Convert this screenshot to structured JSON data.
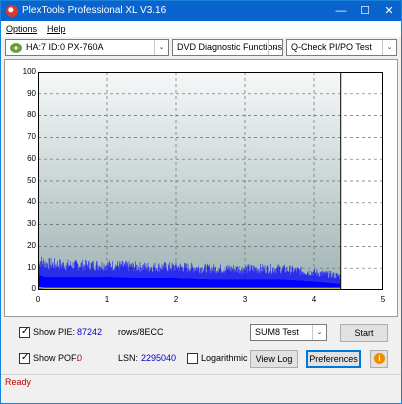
{
  "window": {
    "title": "PlexTools Professional XL V3.16"
  },
  "menu": {
    "options": "Options",
    "help": "Help"
  },
  "toolbar": {
    "drive": "HA:7 ID:0  PX-760A",
    "function": "DVD Diagnostic Functions",
    "test": "Q-Check  PI/PO Test"
  },
  "chart_data": {
    "type": "area",
    "x_ticks": [
      "0",
      "1",
      "2",
      "3",
      "4",
      "5"
    ],
    "y_ticks": [
      "100",
      "90",
      "80",
      "70",
      "60",
      "50",
      "40",
      "30",
      "20",
      "10",
      "0"
    ],
    "xlim": [
      0,
      5
    ],
    "ylim": [
      0,
      100
    ],
    "data_end_x": 4.38,
    "grid": true,
    "series": [
      {
        "style": "spikes",
        "color": "#0000ff",
        "x": [
          0,
          0.1,
          0.5,
          1,
          1.5,
          2,
          2.5,
          3,
          3.5,
          4,
          4.38
        ],
        "values": [
          17,
          15,
          14,
          14,
          13,
          13,
          12,
          12,
          12,
          10,
          8
        ]
      },
      {
        "style": "fill",
        "color": "#0000ff",
        "x": [
          0,
          0.1,
          0.5,
          1,
          1.5,
          2,
          2.5,
          3,
          3.5,
          4,
          4.38
        ],
        "values": [
          7,
          6,
          6,
          6,
          5.5,
          5.5,
          5,
          5,
          5,
          4,
          3
        ]
      },
      {
        "style": "line",
        "color": "#ffff00",
        "x": [
          0,
          0.1,
          0.5,
          1,
          1.5,
          2,
          2.5,
          3,
          3.5,
          4,
          4.38
        ],
        "values": [
          1,
          0.8,
          0.8,
          0.8,
          0.8,
          0.8,
          0.8,
          0.8,
          0.8,
          0.8,
          0.8
        ]
      }
    ]
  },
  "bottom": {
    "show_pie_label": "Show PIE:",
    "pie_value": "87242",
    "rows_unit": "rows/8ECC",
    "show_pof_label": "Show POF:",
    "pof_value": "0",
    "lsn_label": "LSN:",
    "lsn_value": "2295040",
    "log_label": "Logarithmic",
    "sum_select": "SUM8 Test",
    "start_label": "Start",
    "view_log_label": "View Log",
    "preferences_label": "Preferences",
    "show_pie_checked": true,
    "show_pof_checked": true,
    "log_checked": false,
    "check_glyph": "✓",
    "info_glyph": "i",
    "arrow_glyph": "⌄"
  },
  "status": {
    "text": "Ready"
  },
  "colors": {
    "plot_top": "#f6f8f8",
    "plot_bottom": "#9fb3b3",
    "series": "#0000ff",
    "po_line": "#ffff00",
    "status": "#c00000"
  }
}
